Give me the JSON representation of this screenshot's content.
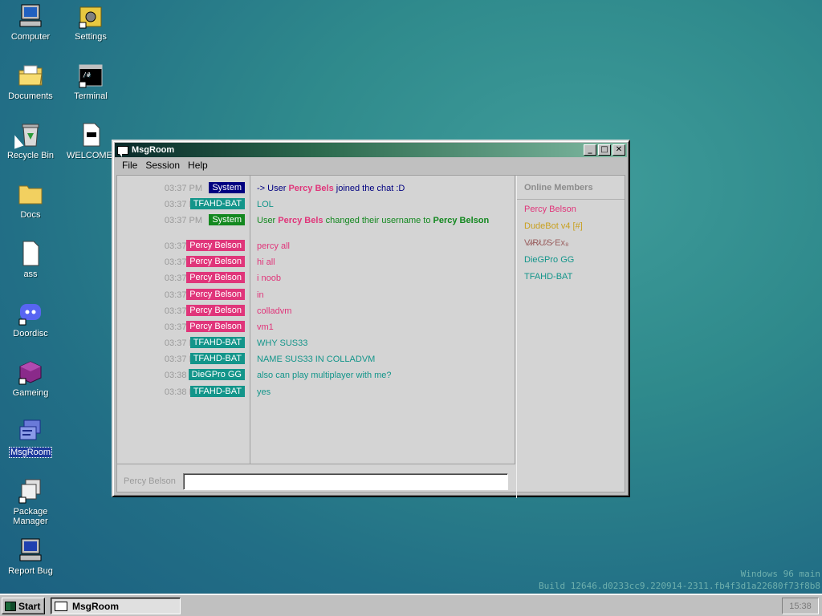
{
  "desktop": {
    "icons": [
      {
        "label": "Computer"
      },
      {
        "label": "Settings"
      },
      {
        "label": "Documents"
      },
      {
        "label": "Terminal"
      },
      {
        "label": "Recycle Bin"
      },
      {
        "label": "WELCOME."
      },
      {
        "label": "Docs"
      },
      {
        "label": "ass"
      },
      {
        "label": "Doordisc"
      },
      {
        "label": "Gameing"
      },
      {
        "label": "MsgRoom"
      },
      {
        "label": "Package Manager"
      },
      {
        "label": "Report Bug"
      }
    ]
  },
  "window": {
    "title": "MsgRoom",
    "buttons": {
      "minimize": "_",
      "maximize": "□",
      "close": "✕"
    },
    "menu": [
      "File",
      "Session",
      "Help"
    ]
  },
  "chat": {
    "messages": [
      {
        "time": "03:37 PM",
        "user": "System",
        "user_color": "#000080",
        "text": "-> User Percy Bels joined the chat :D",
        "text_color": "#000080"
      },
      {
        "time": "03:37 PM",
        "user": "TFAHD-BAT",
        "user_color": "#13958a",
        "text": "LOL",
        "text_color": "#13958a"
      },
      {
        "time": "03:37 PM",
        "user": "System",
        "user_color": "#13881f",
        "text": "User Percy Bels changed their username to Percy Belson",
        "text_color": "#13881f"
      },
      {
        "time": "03:37 PM",
        "user": "Percy Belson",
        "user_color": "#e0357a",
        "text": "percy all",
        "text_color": "#e0357a"
      },
      {
        "time": "03:37 PM",
        "user": "Percy Belson",
        "user_color": "#e0357a",
        "text": "hi all",
        "text_color": "#e0357a"
      },
      {
        "time": "03:37 PM",
        "user": "Percy Belson",
        "user_color": "#e0357a",
        "text": "i noob",
        "text_color": "#e0357a"
      },
      {
        "time": "03:37 PM",
        "user": "Percy Belson",
        "user_color": "#e0357a",
        "text": "in",
        "text_color": "#e0357a"
      },
      {
        "time": "03:37 PM",
        "user": "Percy Belson",
        "user_color": "#e0357a",
        "text": "colladvm",
        "text_color": "#e0357a"
      },
      {
        "time": "03:37 PM",
        "user": "Percy Belson",
        "user_color": "#e0357a",
        "text": "vm1",
        "text_color": "#e0357a"
      },
      {
        "time": "03:37 PM",
        "user": "TFAHD-BAT",
        "user_color": "#13958a",
        "text": "WHY SUS33",
        "text_color": "#13958a"
      },
      {
        "time": "03:37 PM",
        "user": "TFAHD-BAT",
        "user_color": "#13958a",
        "text": "NAME SUS33 IN COLLADVM",
        "text_color": "#13958a"
      },
      {
        "time": "03:38 PM",
        "user": "DieGPro GG",
        "user_color": "#13958a",
        "text": "also can play multiplayer with me?",
        "text_color": "#13958a"
      },
      {
        "time": "03:38 PM",
        "user": "TFAHD-BAT",
        "user_color": "#13958a",
        "text": "yes",
        "text_color": "#13958a"
      }
    ],
    "nickname": "Percy Belson",
    "input_value": ""
  },
  "members": {
    "title": "Online Members",
    "list": [
      {
        "name": "Percy Belson",
        "color": "#e0357a"
      },
      {
        "name": "DudeBot v4 [#]",
        "color": "#c8a020"
      },
      {
        "name": "V̷I̷R̷Ư̷S̷ Ex₈",
        "color": "#9a6060"
      },
      {
        "name": "DieGPro GG",
        "color": "#13958a"
      },
      {
        "name": "TFAHD-BAT",
        "color": "#13958a"
      }
    ]
  },
  "taskbar": {
    "start_label": "Start",
    "task_label": "MsgRoom",
    "clock": "15:38"
  },
  "watermark": {
    "line1": "Windows 96 main",
    "line2": "Build 12646.d0233cc9.220914-2311.fb4f3d1a22680f73f8b8"
  }
}
